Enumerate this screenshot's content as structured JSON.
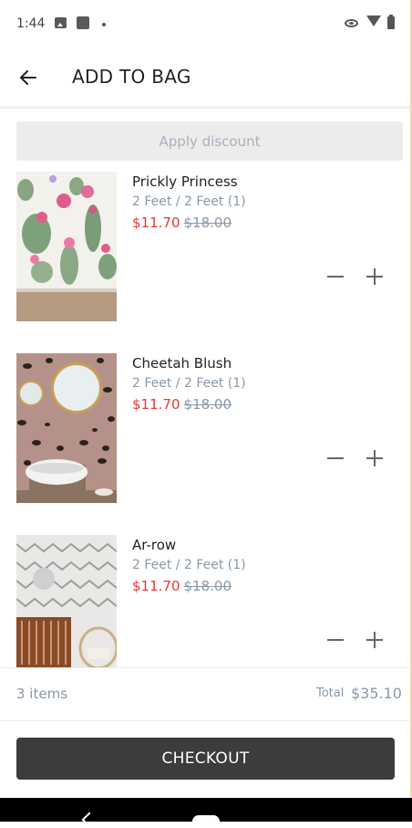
{
  "status_bar": {
    "time": "1:44"
  },
  "header": {
    "title": "ADD TO BAG",
    "back_icon": "arrow-left-icon"
  },
  "discount": {
    "label": "Apply discount"
  },
  "items": [
    {
      "name": "Prickly Princess",
      "variant": "2 Feet / 2 Feet (1)",
      "price": "$11.70",
      "original_price": "$18.00"
    },
    {
      "name": "Cheetah Blush",
      "variant": "2 Feet / 2 Feet (1)",
      "price": "$11.70",
      "original_price": "$18.00"
    },
    {
      "name": "Ar-row",
      "variant": "2 Feet / 2 Feet (1)",
      "price": "$11.70",
      "original_price": "$18.00"
    }
  ],
  "summary": {
    "items_count": "3 items",
    "total_label": "Total",
    "total_value": "$35.10"
  },
  "checkout": {
    "label": "CHECKOUT"
  },
  "colors": {
    "sale": "#e53935",
    "muted": "#8a97a8",
    "checkout_bg": "#3c3c3c"
  }
}
